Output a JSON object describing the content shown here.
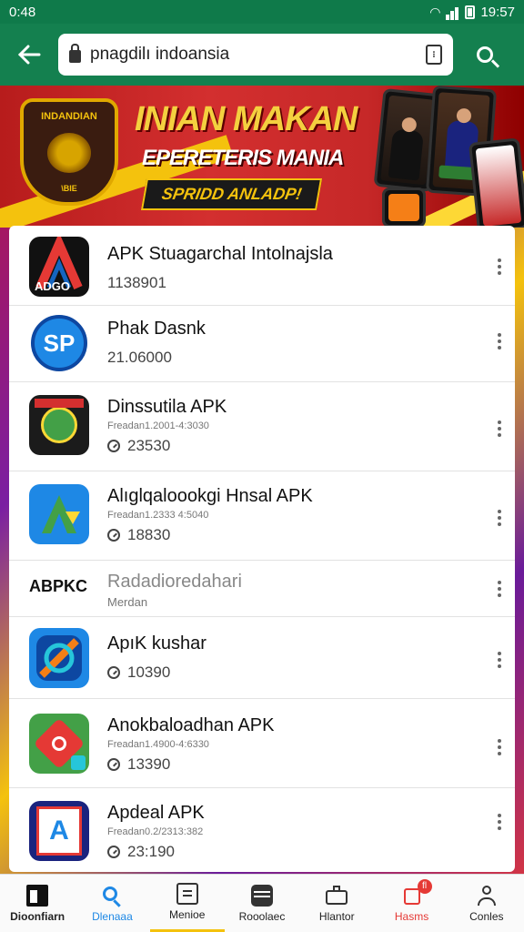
{
  "status_bar": {
    "left_time": "0:48",
    "right_time": "19:57"
  },
  "app_bar": {
    "url": "pnagdilı indoansia",
    "tab_count": "⁝"
  },
  "banner": {
    "emblem_title": "INDANDIAN",
    "emblem_sub": "\\BIE",
    "title": "INIAN MAKAN",
    "subtitle": "EPERETERIS MANIA",
    "button_label": "SPRIDD ANLADP!"
  },
  "list": [
    {
      "title": "APK Stuagarchal Intolnajsla",
      "sub": "",
      "meta": "1138901",
      "icon": "adgo-icon",
      "icon_text": "ADGO",
      "show_meta_icon": false
    },
    {
      "title": "Phak Dasnk",
      "sub": "",
      "meta": "21.06000",
      "icon": "sp-icon",
      "icon_text": "SP",
      "show_meta_icon": false
    },
    {
      "title": "Dinssutila APK",
      "sub": "Freadan1.2001-4:3030",
      "meta": "23530",
      "icon": "soccer-icon",
      "icon_text": "",
      "show_meta_icon": true
    },
    {
      "title": "Alıglqaloookgi Hnsal APK",
      "sub": "Freadan1.2333 4:5040",
      "meta": "18830",
      "icon": "arrow-a-icon",
      "icon_text": "",
      "show_meta_icon": true
    },
    {
      "title": "Radadioredahari",
      "sub": "Merdan",
      "meta": "",
      "icon": "abpkc-icon",
      "icon_text": "ABPKC",
      "show_meta_icon": false
    },
    {
      "title": "ApıK kushar",
      "sub": "",
      "meta": "10390",
      "icon": "kushar-icon",
      "icon_text": "",
      "show_meta_icon": true
    },
    {
      "title": "Anokbaloadhan APK",
      "sub": "Freadan1.4900-4:6330",
      "meta": "13390",
      "icon": "red-tool-icon",
      "icon_text": "",
      "show_meta_icon": true
    },
    {
      "title": "Apdeal APK",
      "sub": "Freadan0.2/2313:382",
      "meta": "23:190",
      "icon": "apdeal-icon",
      "icon_text": "",
      "show_meta_icon": true
    }
  ],
  "bottom_nav": [
    {
      "label": "Dioonfiarn",
      "icon": "home-icon"
    },
    {
      "label": "Dlenaaa",
      "icon": "search-icon"
    },
    {
      "label": "Menioe",
      "icon": "menu-icon"
    },
    {
      "label": "Rooolaec",
      "icon": "storage-icon"
    },
    {
      "label": "Hlantor",
      "icon": "briefcase-icon"
    },
    {
      "label": "Hasms",
      "icon": "notification-icon",
      "badge": "fl"
    },
    {
      "label": "Conles",
      "icon": "profile-icon"
    }
  ],
  "colors": {
    "accent": "#14804f",
    "active_nav": "#1e88e5",
    "alert_nav": "#e53935",
    "active_underline": "#f4c20d"
  }
}
